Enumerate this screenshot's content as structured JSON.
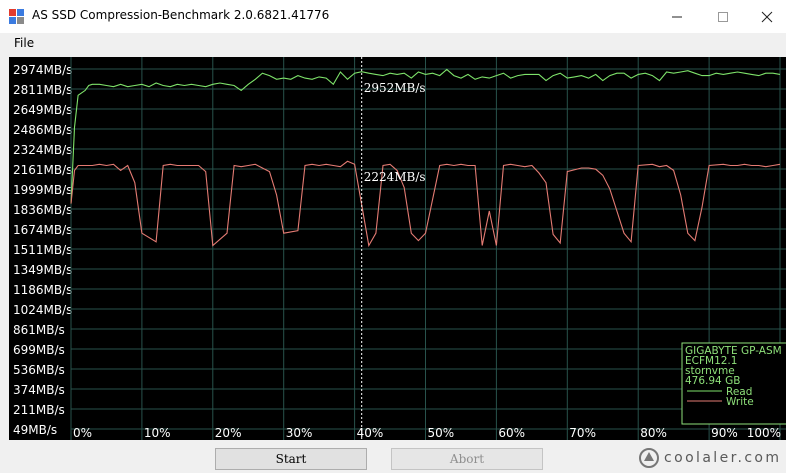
{
  "window": {
    "title": "AS SSD Compression-Benchmark 2.0.6821.41776"
  },
  "menu": {
    "items": [
      {
        "label": "File"
      }
    ]
  },
  "buttons": {
    "start": "Start",
    "abort": "Abort"
  },
  "watermark": {
    "text": "coolaler.com"
  },
  "colors": {
    "read": "#7ee26a",
    "write": "#e47b73",
    "grid": "#28524c",
    "label": "#ffffff",
    "info": "#8ee07a"
  },
  "chart_data": {
    "type": "line",
    "y_tick_labels": [
      "2974MB/s",
      "2811MB/s",
      "2649MB/s",
      "2486MB/s",
      "2324MB/s",
      "2161MB/s",
      "1999MB/s",
      "1836MB/s",
      "1674MB/s",
      "1511MB/s",
      "1349MB/s",
      "1186MB/s",
      "1024MB/s",
      "861MB/s",
      "699MB/s",
      "536MB/s",
      "374MB/s",
      "211MB/s",
      "49MB/s"
    ],
    "x_tick_labels": [
      "0%",
      "10%",
      "20%",
      "30%",
      "40%",
      "50%",
      "60%",
      "70%",
      "80%",
      "90%",
      "100%"
    ],
    "ylim": [
      49,
      2974
    ],
    "xlim": [
      0,
      100
    ],
    "cursor": {
      "x": 41,
      "read_label": "2952MB/s",
      "write_label": "2224MB/s"
    },
    "info_panel": {
      "lines": [
        "GIGABYTE GP-ASM",
        "ECFM12.1",
        "stornvme",
        "476.94 GB"
      ],
      "legend": [
        {
          "name": "Read"
        },
        {
          "name": "Write"
        }
      ]
    },
    "series": [
      {
        "name": "Read",
        "x": [
          0,
          0.5,
          1,
          2,
          2.5,
          3,
          4,
          5,
          6,
          7,
          8,
          9,
          10,
          11,
          12,
          13,
          14,
          15,
          16,
          17,
          18,
          19,
          20,
          21,
          22,
          23,
          24,
          25,
          26,
          27,
          28,
          29,
          30,
          31,
          32,
          33,
          34,
          35,
          36,
          37,
          38,
          39,
          40,
          41,
          42,
          43,
          44,
          45,
          46,
          47,
          48,
          49,
          50,
          51,
          52,
          53,
          54,
          55,
          56,
          57,
          58,
          59,
          60,
          61,
          62,
          63,
          64,
          65,
          66,
          67,
          68,
          69,
          70,
          71,
          72,
          73,
          74,
          75,
          76,
          77,
          78,
          79,
          80,
          81,
          82,
          83,
          84,
          85,
          86,
          87,
          88,
          89,
          90,
          91,
          92,
          93,
          94,
          95,
          96,
          97,
          98,
          99,
          100
        ],
        "values": [
          1880,
          2500,
          2760,
          2800,
          2840,
          2850,
          2850,
          2840,
          2830,
          2850,
          2830,
          2840,
          2850,
          2830,
          2860,
          2840,
          2830,
          2850,
          2840,
          2850,
          2840,
          2830,
          2850,
          2860,
          2850,
          2840,
          2800,
          2850,
          2890,
          2940,
          2920,
          2890,
          2900,
          2890,
          2920,
          2900,
          2890,
          2910,
          2900,
          2850,
          2950,
          2890,
          2940,
          2952,
          2940,
          2930,
          2920,
          2940,
          2930,
          2940,
          2900,
          2950,
          2930,
          2940,
          2920,
          2970,
          2920,
          2900,
          2930,
          2890,
          2910,
          2900,
          2920,
          2940,
          2900,
          2920,
          2930,
          2930,
          2930,
          2880,
          2920,
          2940,
          2900,
          2910,
          2920,
          2900,
          2930,
          2880,
          2920,
          2940,
          2940,
          2900,
          2930,
          2940,
          2920,
          2880,
          2950,
          2940,
          2950,
          2960,
          2940,
          2920,
          2920,
          2940,
          2930,
          2940,
          2950,
          2940,
          2930,
          2920,
          2940,
          2940,
          2930
        ]
      },
      {
        "name": "Write",
        "x": [
          0,
          0.5,
          1,
          2,
          3,
          4,
          5,
          6,
          7,
          8,
          9,
          10,
          12,
          13,
          14,
          15,
          16,
          17,
          18,
          19,
          20,
          22,
          23,
          24,
          25,
          26,
          27,
          28,
          29,
          30,
          32,
          33,
          34,
          35,
          36,
          37,
          38,
          39,
          40,
          42,
          43,
          44,
          45,
          46,
          47,
          48,
          49,
          50,
          52,
          53,
          54,
          55,
          56,
          57,
          58,
          59,
          60,
          61,
          62,
          63,
          64,
          65,
          66,
          67,
          68,
          69,
          70,
          72,
          73,
          74,
          75,
          76,
          77,
          78,
          79,
          80,
          82,
          83,
          84,
          85,
          86,
          87,
          88,
          89,
          90,
          92,
          93,
          94,
          95,
          96,
          97,
          98,
          99,
          100
        ],
        "values": [
          1880,
          2150,
          2190,
          2190,
          2190,
          2200,
          2190,
          2200,
          2150,
          2190,
          2050,
          1640,
          1570,
          2190,
          2200,
          2190,
          2190,
          2190,
          2190,
          2140,
          1540,
          1640,
          2190,
          2180,
          2190,
          2200,
          2170,
          2140,
          1950,
          1640,
          1660,
          2190,
          2200,
          2190,
          2200,
          2190,
          2180,
          2224,
          2200,
          1540,
          1640,
          2190,
          2200,
          2150,
          2010,
          1640,
          1580,
          1640,
          2190,
          2200,
          2190,
          2200,
          2190,
          2190,
          1540,
          1820,
          1540,
          2190,
          2200,
          2190,
          2180,
          2190,
          2130,
          2050,
          1630,
          1560,
          2140,
          2170,
          2170,
          2160,
          2110,
          2000,
          1820,
          1640,
          1570,
          2190,
          2200,
          2180,
          2190,
          2150,
          1950,
          1640,
          1580,
          1850,
          2190,
          2200,
          2190,
          2190,
          2200,
          2190,
          2190,
          2180,
          2190,
          2200
        ]
      }
    ]
  }
}
